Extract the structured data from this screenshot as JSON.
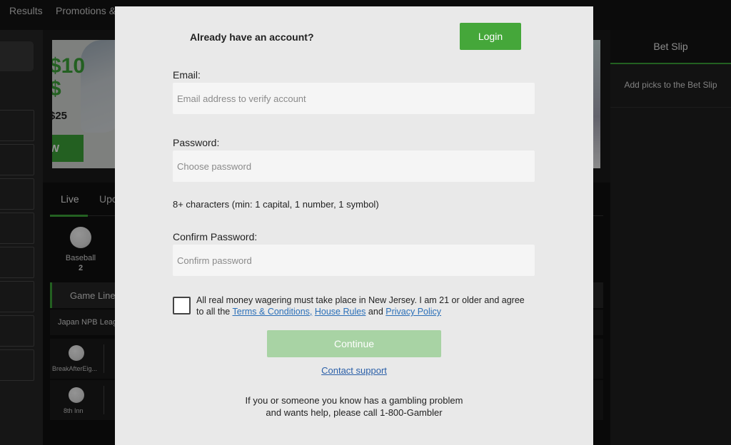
{
  "topnav": {
    "results": "Results",
    "promotions": "Promotions &"
  },
  "banner": {
    "amount": "$10",
    "sub": "$",
    "line": "$25",
    "btn": "W"
  },
  "tabs": {
    "live": "Live",
    "upcoming": "Upc"
  },
  "sports": [
    {
      "label": "Baseball",
      "count": "2"
    }
  ],
  "gameline": {
    "label": "Game Line"
  },
  "league": {
    "label": "Japan NPB Leag"
  },
  "events": [
    {
      "label": "BreakAfterEig..."
    },
    {
      "label": "8th Inn"
    }
  ],
  "betslip": {
    "title": "Bet Slip",
    "message": "Add picks to the Bet Slip"
  },
  "modal": {
    "already": "Already have an account?",
    "login_label": "Login",
    "email_label": "Email:",
    "email_placeholder": "Email address to verify account",
    "password_label": "Password:",
    "password_placeholder": "Choose password",
    "password_hint": "8+ characters (min: 1 capital, 1 number, 1 symbol)",
    "confirm_label": "Confirm Password:",
    "confirm_placeholder": "Confirm password",
    "terms_prefix": "All real money wagering must take place in New Jersey. I am 21 or older and agree to all the ",
    "terms_link": "Terms & Conditions,",
    "house_link": "House Rules",
    "and_text": " and ",
    "privacy_link": "Privacy Policy",
    "continue_label": "Continue",
    "contact_label": "Contact support",
    "gamble_line1": "If you or someone you know has a gambling problem",
    "gamble_line2": "and wants help, please call 1-800-Gambler"
  },
  "colors": {
    "accent": "#45a73a",
    "continue_disabled": "#a8d3a4",
    "link": "#2a6fb8"
  }
}
